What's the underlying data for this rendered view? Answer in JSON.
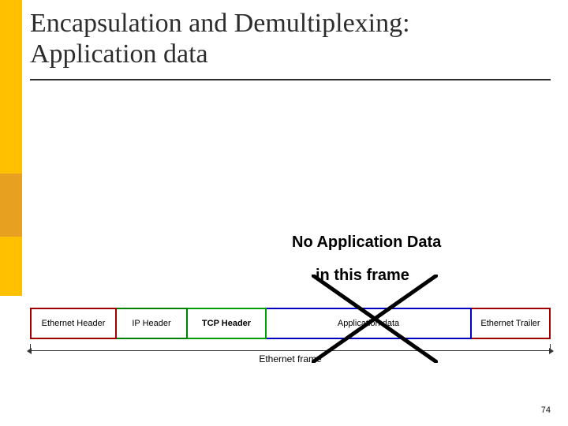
{
  "title_line1": "Encapsulation and Demultiplexing:",
  "title_line2": "Application data",
  "caption_line1": "No Application Data",
  "caption_line2": "in this frame",
  "frame": {
    "segments": {
      "ethernet_header": "Ethernet Header",
      "ip_header": "IP Header",
      "tcp_header": "TCP Header",
      "app_data": "Application data",
      "ethernet_trailer": "Ethernet Trailer"
    },
    "label": "Ethernet frame"
  },
  "page_number": "74"
}
